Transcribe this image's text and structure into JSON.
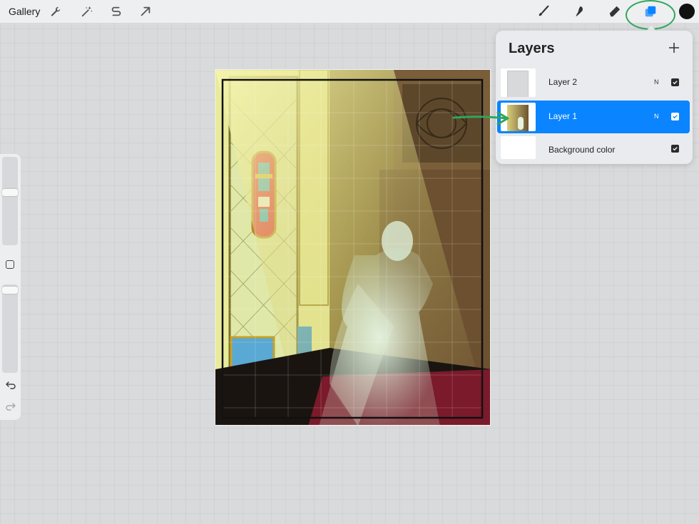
{
  "toolbar": {
    "gallery_label": "Gallery",
    "left_tools": [
      "wrench-icon",
      "magic-wand-icon",
      "selection-s-icon",
      "transform-arrow-icon"
    ],
    "right_tools": [
      "brush-icon",
      "smudge-icon",
      "eraser-icon",
      "layers-icon"
    ],
    "current_color": "#111111",
    "active_tool_color": "#0a84ff",
    "annotation_color": "#2fa65b"
  },
  "sidebar": {
    "brush_size_level": 0.33,
    "opacity_level": 0.03
  },
  "layers_panel": {
    "title": "Layers",
    "add_icon": "plus-icon",
    "layers": [
      {
        "name": "Layer 2",
        "blend": "N",
        "visible": true,
        "selected": false
      },
      {
        "name": "Layer 1",
        "blend": "N",
        "visible": true,
        "selected": true
      },
      {
        "name": "Background color",
        "visible": true,
        "selected": false
      }
    ]
  }
}
